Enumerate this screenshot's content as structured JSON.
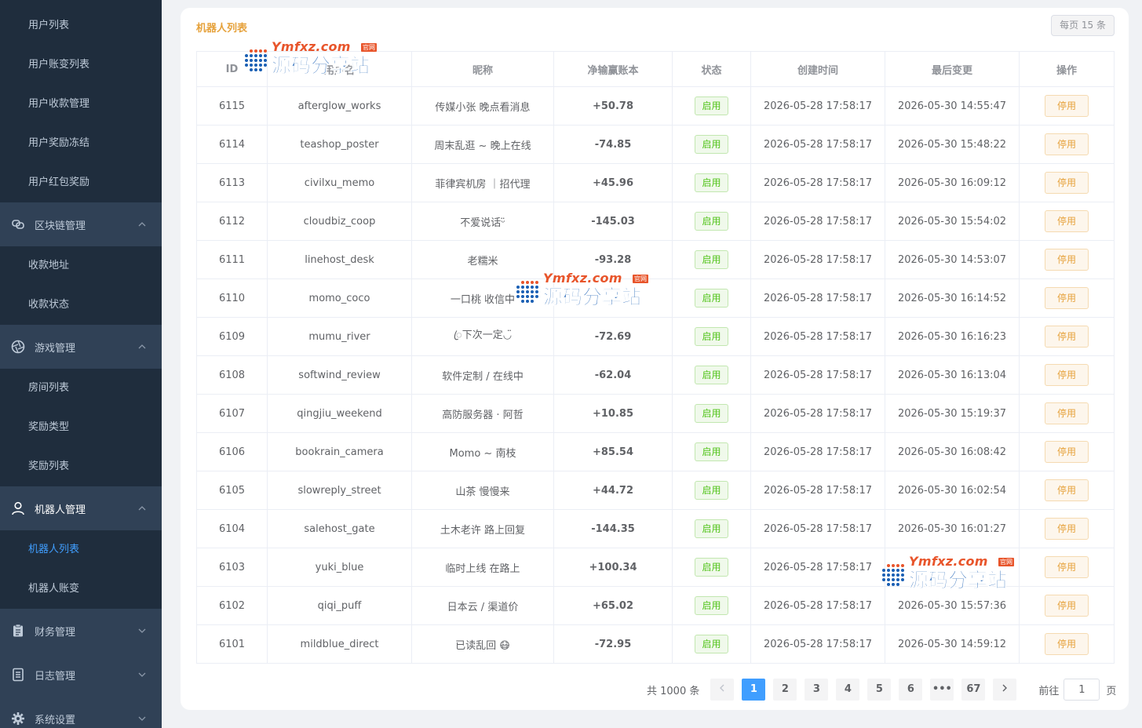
{
  "sidebar": {
    "user_items": [
      "用户列表",
      "用户账变列表",
      "用户收款管理",
      "用户奖励冻结",
      "用户红包奖励"
    ],
    "chain_group": "区块链管理",
    "chain_items": [
      "收款地址",
      "收款状态"
    ],
    "game_group": "游戏管理",
    "game_items": [
      "房间列表",
      "奖励类型",
      "奖励列表"
    ],
    "robot_group": "机器人管理",
    "robot_items": [
      "机器人列表",
      "机器人账变"
    ],
    "finance_group": "财务管理",
    "log_group": "日志管理",
    "settings_group": "系统设置"
  },
  "card": {
    "title": "机器人列表",
    "per_page": "每页 15 条"
  },
  "table": {
    "headers": [
      "ID",
      "用户名",
      "昵称",
      "净输赢账本",
      "状态",
      "创建时间",
      "最后变更",
      "操作"
    ],
    "status_label": "启用",
    "action_label": "停用",
    "rows": [
      {
        "id": "6115",
        "username": "afterglow_works",
        "nickname": "传媒小张 晚点看消息",
        "net": "+50.78",
        "created": "2026-05-28 17:58:17",
        "updated": "2026-05-30 14:55:47"
      },
      {
        "id": "6114",
        "username": "teashop_poster",
        "nickname": "周末乱逛 ~ 晚上在线",
        "net": "-74.85",
        "created": "2026-05-28 17:58:17",
        "updated": "2026-05-30 15:48:22"
      },
      {
        "id": "6113",
        "username": "civilxu_memo",
        "nickname": "菲律宾机房 ｜招代理",
        "net": "+45.96",
        "created": "2026-05-28 17:58:17",
        "updated": "2026-05-30 16:09:12"
      },
      {
        "id": "6112",
        "username": "cloudbiz_coop",
        "nickname": "不爱说话ᵕ̈",
        "net": "-145.03",
        "created": "2026-05-28 17:58:17",
        "updated": "2026-05-30 15:54:02"
      },
      {
        "id": "6111",
        "username": "linehost_desk",
        "nickname": "老糯米",
        "net": "-93.28",
        "created": "2026-05-28 17:58:17",
        "updated": "2026-05-30 14:53:07"
      },
      {
        "id": "6110",
        "username": "momo_coco",
        "nickname": "一口桃 收信中",
        "net": "",
        "created": "2026-05-28 17:58:17",
        "updated": "2026-05-30 16:14:52"
      },
      {
        "id": "6109",
        "username": "mumu_river",
        "nickname": "ꦿ下次一定◡̈",
        "net": "-72.69",
        "created": "2026-05-28 17:58:17",
        "updated": "2026-05-30 16:16:23"
      },
      {
        "id": "6108",
        "username": "softwind_review",
        "nickname": "软件定制 / 在线中",
        "net": "-62.04",
        "created": "2026-05-28 17:58:17",
        "updated": "2026-05-30 16:13:04"
      },
      {
        "id": "6107",
        "username": "qingjiu_weekend",
        "nickname": "高防服务器 · 阿哲",
        "net": "+10.85",
        "created": "2026-05-28 17:58:17",
        "updated": "2026-05-30 15:19:37"
      },
      {
        "id": "6106",
        "username": "bookrain_camera",
        "nickname": "Momo ~ 南枝",
        "net": "+85.54",
        "created": "2026-05-28 17:58:17",
        "updated": "2026-05-30 16:08:42"
      },
      {
        "id": "6105",
        "username": "slowreply_street",
        "nickname": "山茶 慢慢来",
        "net": "+44.72",
        "created": "2026-05-28 17:58:17",
        "updated": "2026-05-30 16:02:54"
      },
      {
        "id": "6104",
        "username": "salehost_gate",
        "nickname": "土木老许 路上回复",
        "net": "-144.35",
        "created": "2026-05-28 17:58:17",
        "updated": "2026-05-30 16:01:27"
      },
      {
        "id": "6103",
        "username": "yuki_blue",
        "nickname": "临时上线 在路上",
        "net": "+100.34",
        "created": "2026-05-28 17:58:17",
        "updated": ""
      },
      {
        "id": "6102",
        "username": "qiqi_puff",
        "nickname": "日本云 / 渠道价",
        "net": "+65.02",
        "created": "2026-05-28 17:58:17",
        "updated": "2026-05-30 15:57:36"
      },
      {
        "id": "6101",
        "username": "mildblue_direct",
        "nickname": "已读乱回 😷",
        "net": "-72.95",
        "created": "2026-05-28 17:58:17",
        "updated": "2026-05-30 14:59:12"
      }
    ]
  },
  "pagination": {
    "total": "共 1000 条",
    "pages": [
      "1",
      "2",
      "3",
      "4",
      "5",
      "6",
      "•••",
      "67"
    ],
    "current": "1",
    "goto_label": "前往",
    "goto_value": "1",
    "goto_suffix": "页"
  },
  "watermark": {
    "url": "Ymfxz.com",
    "badge": "官网",
    "name": "源码分享站"
  },
  "colors": {
    "sidebar_bg": "#1f2d3d",
    "sidebar_group_bg": "#304156",
    "accent": "#409eff",
    "positive": "#13a05e",
    "negative": "#e02020",
    "title": "#e6a23c"
  },
  "icons": {
    "chain": "blockchain-icon",
    "game": "aperture-icon",
    "robot": "user-icon",
    "finance": "clipboard-icon",
    "log": "document-icon",
    "settings": "gear-icon"
  }
}
